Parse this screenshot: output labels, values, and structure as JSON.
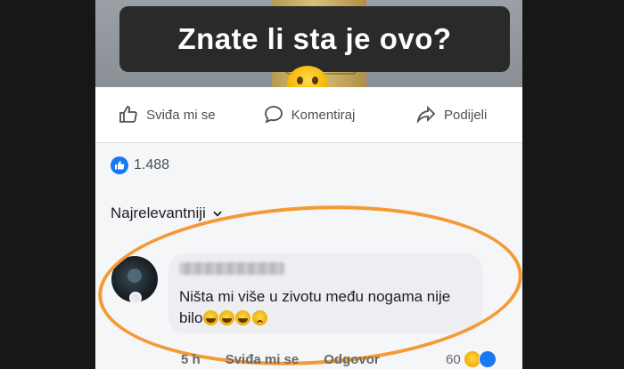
{
  "post": {
    "overlay_caption": "Znate li sta je ovo?"
  },
  "actions": {
    "like_label": "Sviđa mi se",
    "comment_label": "Komentiraj",
    "share_label": "Podijeli"
  },
  "reactions": {
    "count": "1.488"
  },
  "comments_section": {
    "sort_label": "Najrelevantniji"
  },
  "comment": {
    "text": "Ništa mi više u zivotu među nogama nije bilo",
    "time": "5 h",
    "like_label": "Sviđa mi se",
    "reply_label": "Odgovor",
    "reaction_count": "60"
  },
  "colors": {
    "facebook_blue": "#1877f2",
    "highlight_orange": "#f39a34"
  }
}
